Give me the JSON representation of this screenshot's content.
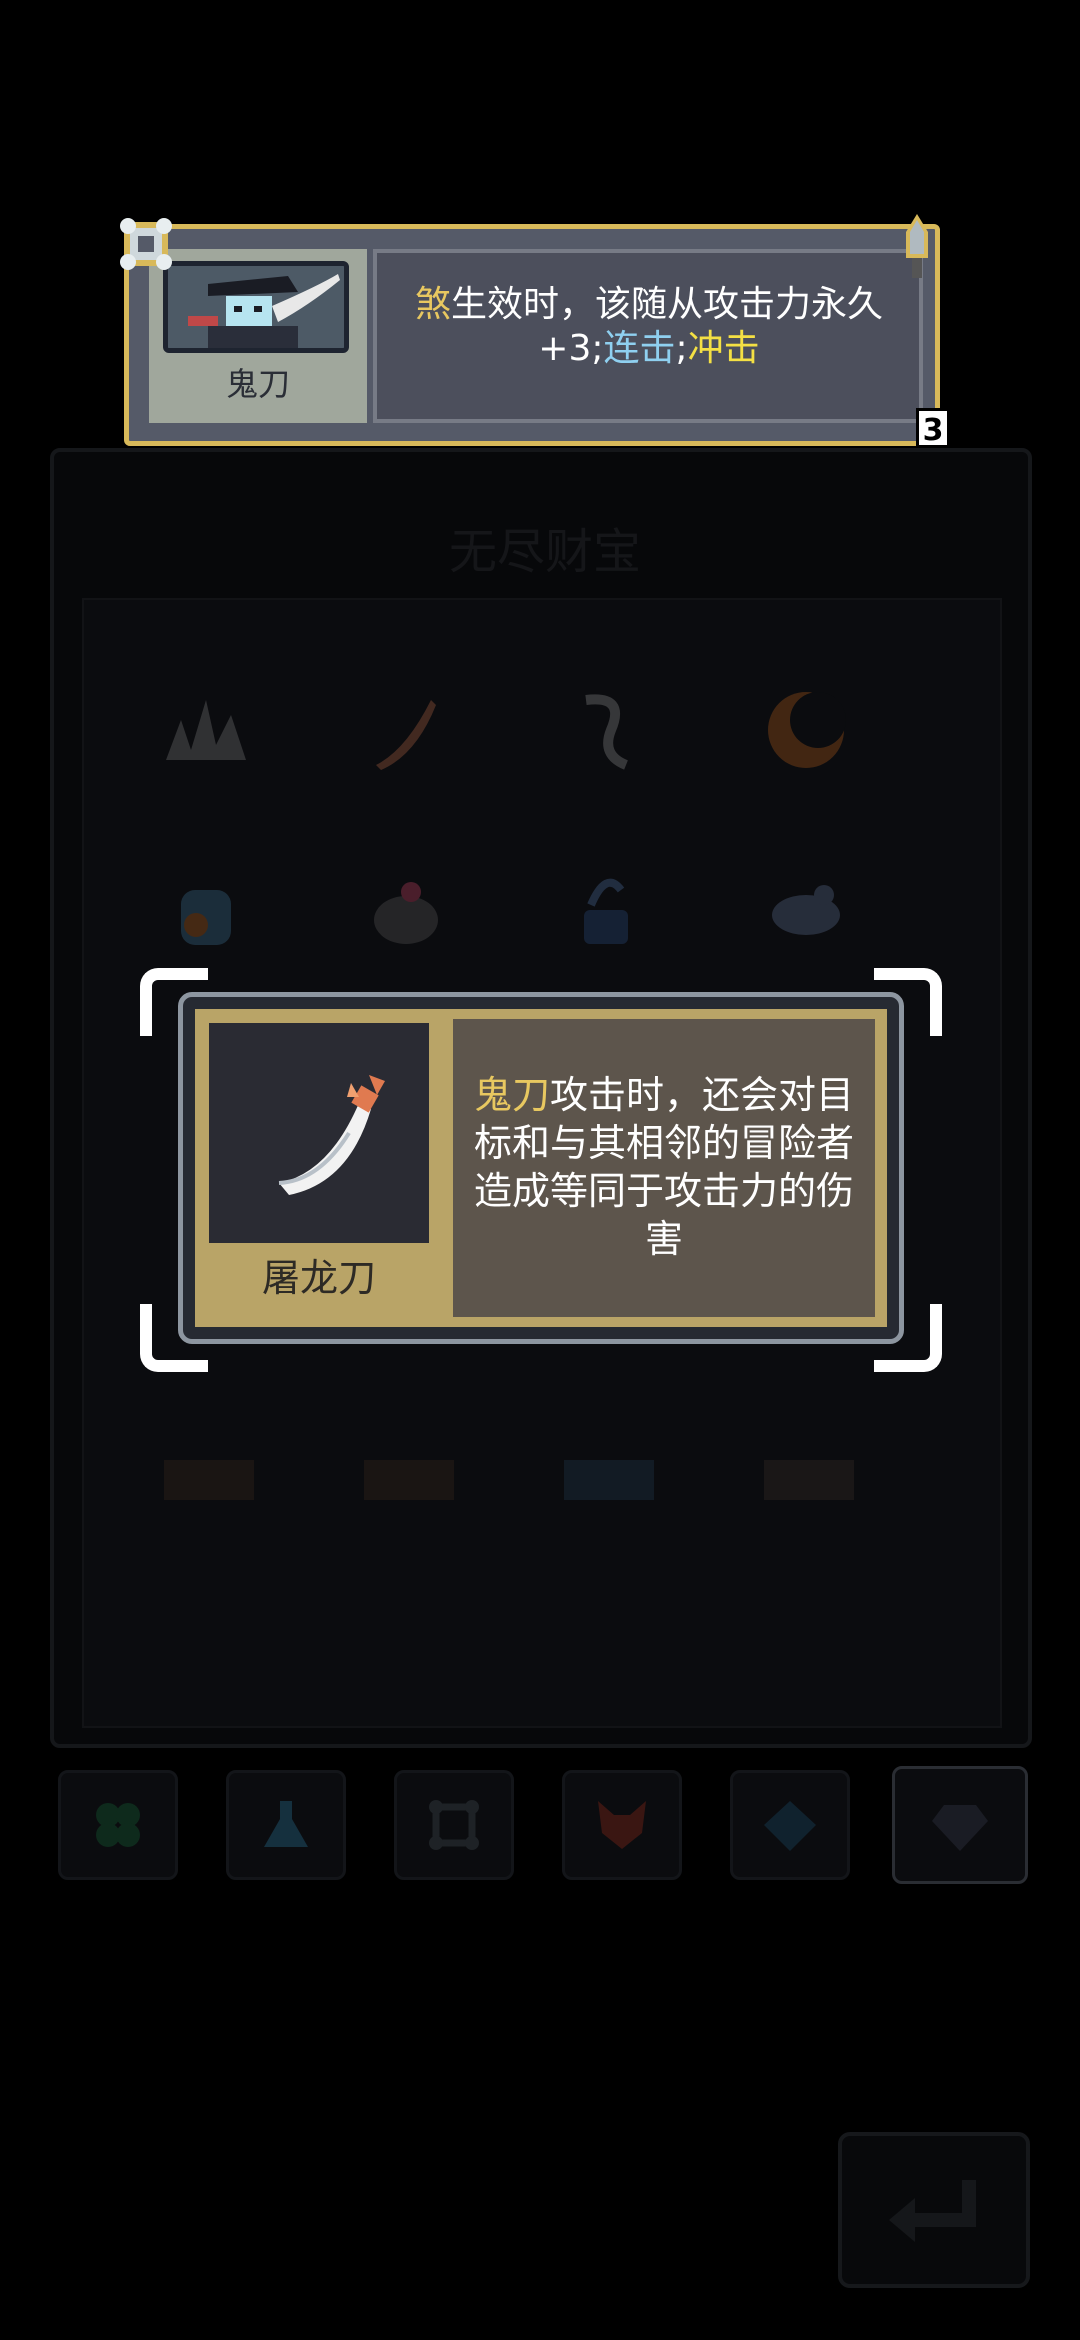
{
  "companion": {
    "name": "鬼刀",
    "desc_keyword": "煞",
    "desc_line1": "生效时，该随从攻击力永久",
    "desc_value": "+3",
    "desc_sep1": ";",
    "desc_combo": "连击",
    "desc_sep2": ";",
    "desc_impact": "冲击",
    "badge": "3"
  },
  "panel": {
    "title": "无尽财宝"
  },
  "item": {
    "name": "屠龙刀",
    "desc_owner": "鬼刀",
    "desc_text": "攻击时，还会对目标和与其相邻的冒险者造成等同于攻击力的伤害"
  },
  "tabs": [
    {
      "icon": "clover-icon"
    },
    {
      "icon": "flask-icon"
    },
    {
      "icon": "bone-frame-icon"
    },
    {
      "icon": "fox-mask-icon"
    },
    {
      "icon": "gem-icon"
    },
    {
      "icon": "diamond-icon"
    }
  ],
  "colors": {
    "gold_border": "#d8b95a",
    "keyword_yellow": "#f4e044",
    "keyword_blue": "#8fd0f0",
    "item_frame": "#b9a467"
  }
}
